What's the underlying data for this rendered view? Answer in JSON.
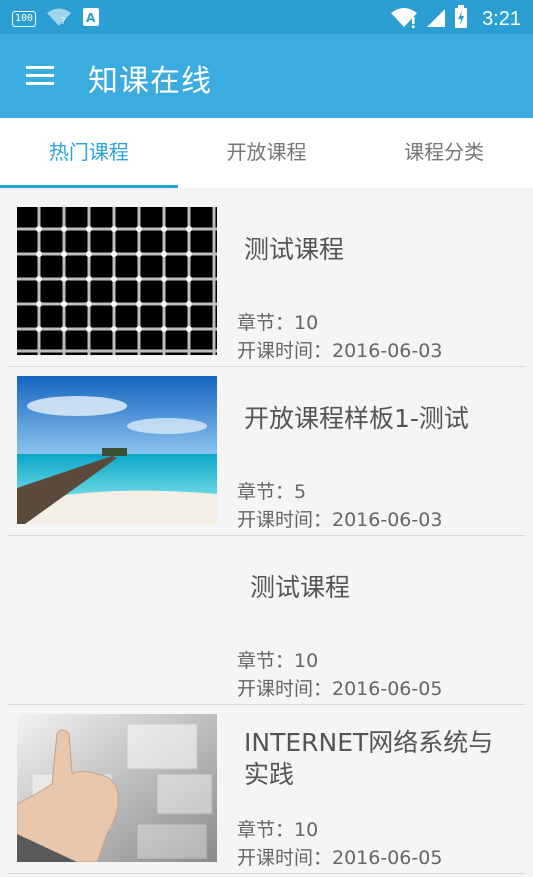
{
  "status_bar": {
    "battery_saver_badge": "100",
    "time": "3:21"
  },
  "app_bar": {
    "title": "知课在线"
  },
  "tabs": [
    {
      "label": "热门课程",
      "active": true
    },
    {
      "label": "开放课程",
      "active": false
    },
    {
      "label": "课程分类",
      "active": false
    }
  ],
  "courses": [
    {
      "title": "测试课程",
      "chapters": "章节：10",
      "open_time": "开课时间：2016-06-03",
      "thumbnail": "grid-illusion-image"
    },
    {
      "title": "开放课程样板1-测试",
      "chapters": "章节：5",
      "open_time": "开课时间：2016-06-03",
      "thumbnail": "beach-pier-image"
    },
    {
      "title": "测试课程",
      "chapters": "章节：10",
      "open_time": "开课时间：2016-06-05",
      "thumbnail": "none"
    },
    {
      "title": "INTERNET网络系统与实践",
      "chapters": "章节：10",
      "open_time": "开课时间：2016-06-05",
      "thumbnail": "touchscreen-hand-image"
    }
  ],
  "colors": {
    "status_bar": "#2b9fd3",
    "app_bar": "#3aace0",
    "accent": "#2ba4dc"
  }
}
